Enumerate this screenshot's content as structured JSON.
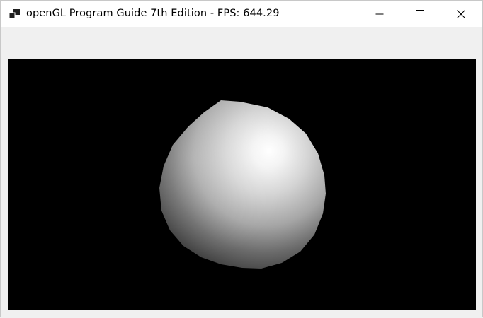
{
  "window": {
    "title": "openGL Program Guide 7th Edition - FPS: 644.29",
    "app_icon": "app-window-icon",
    "controls": {
      "minimize_icon": "minimize-icon",
      "maximize_icon": "maximize-icon",
      "close_icon": "close-icon"
    }
  },
  "viewport": {
    "background_color": "#000000",
    "object": "lit-sphere",
    "sphere_highlight_color": "#ffffff",
    "sphere_shadow_color": "#3a3a3a"
  }
}
